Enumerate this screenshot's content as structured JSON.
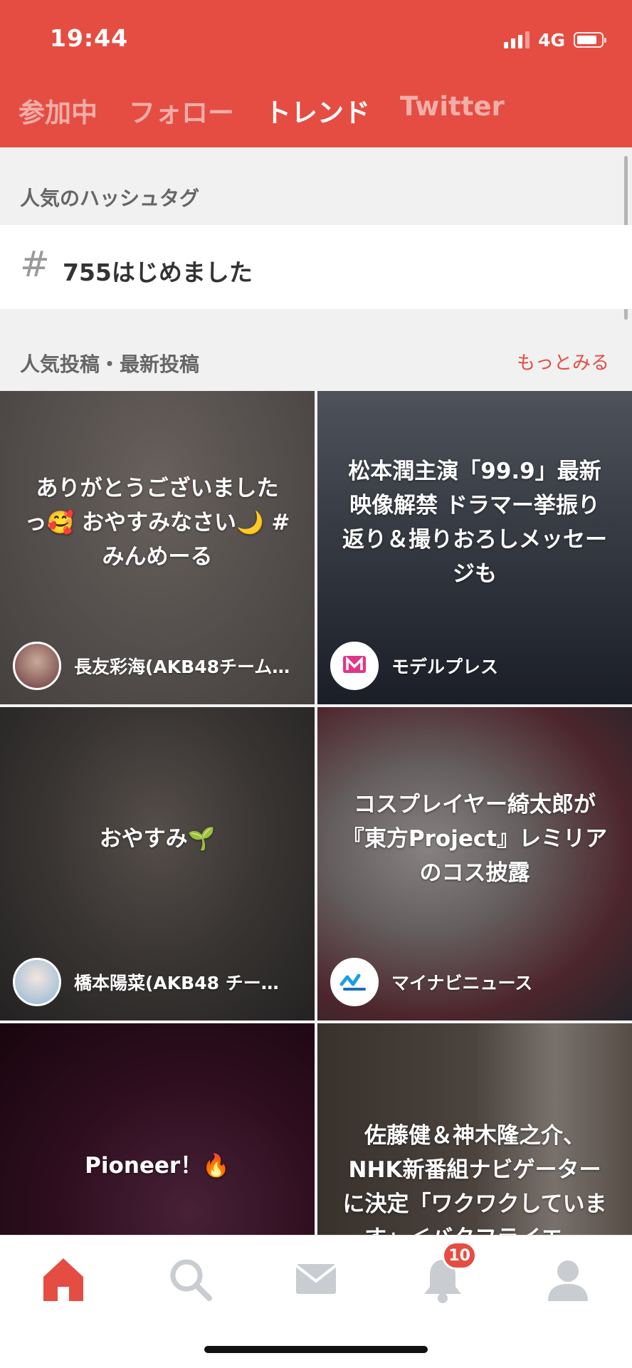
{
  "status_bar": {
    "time": "19:44",
    "network": "4G",
    "signal_bars": 4,
    "signal_bars_active": 3,
    "battery_level": 0.7
  },
  "tabs": [
    {
      "label": "参加中",
      "active": false
    },
    {
      "label": "フォロー",
      "active": false
    },
    {
      "label": "トレンド",
      "active": true
    },
    {
      "label": "Twitter",
      "active": false
    }
  ],
  "popular_hashtags": {
    "heading": "人気のハッシュタグ",
    "symbol": "#",
    "items": [
      "755はじめました"
    ]
  },
  "posts": {
    "heading": "人気投稿・最新投稿",
    "more_label": "もっとみる",
    "cards": [
      {
        "text": "ありがとうございました っ🥰 おやすみなさい🌙 #みんめーる",
        "author": "長友彩海(AKB48チーム…",
        "avatar_icon": "user-photo-avatar"
      },
      {
        "text": "松本潤主演「99.9」最新映像解禁 ドラマー挙振り返り＆撮りおろしメッセージも",
        "author": "モデルプレス",
        "avatar_icon": "modelpress-logo"
      },
      {
        "text": "おやすみ🌱",
        "author": "橋本陽菜(AKB48 チー…",
        "avatar_icon": "user-photo-avatar"
      },
      {
        "text": "コスプレイヤー綺太郎が『東方Project』レミリアのコス披露",
        "author": "マイナビニュース",
        "avatar_icon": "mynavi-news-logo"
      },
      {
        "text": "Pioneer！🔥",
        "author": "",
        "avatar_icon": ""
      },
      {
        "text": "佐藤健＆神木隆之介、NHK新番組ナビゲーターに決定「ワクワクしています」＜バタフライエ…",
        "author": "",
        "avatar_icon": ""
      }
    ]
  },
  "bottom_nav": {
    "items": [
      {
        "icon": "home-icon",
        "active": true
      },
      {
        "icon": "search-icon",
        "active": false
      },
      {
        "icon": "mail-icon",
        "active": false
      },
      {
        "icon": "bell-icon",
        "active": false,
        "badge": "10"
      },
      {
        "icon": "profile-icon",
        "active": false
      }
    ]
  },
  "colors": {
    "brand": "#e54d42",
    "inactive_icon": "#c9ccd1",
    "background": "#f1f1f1"
  }
}
